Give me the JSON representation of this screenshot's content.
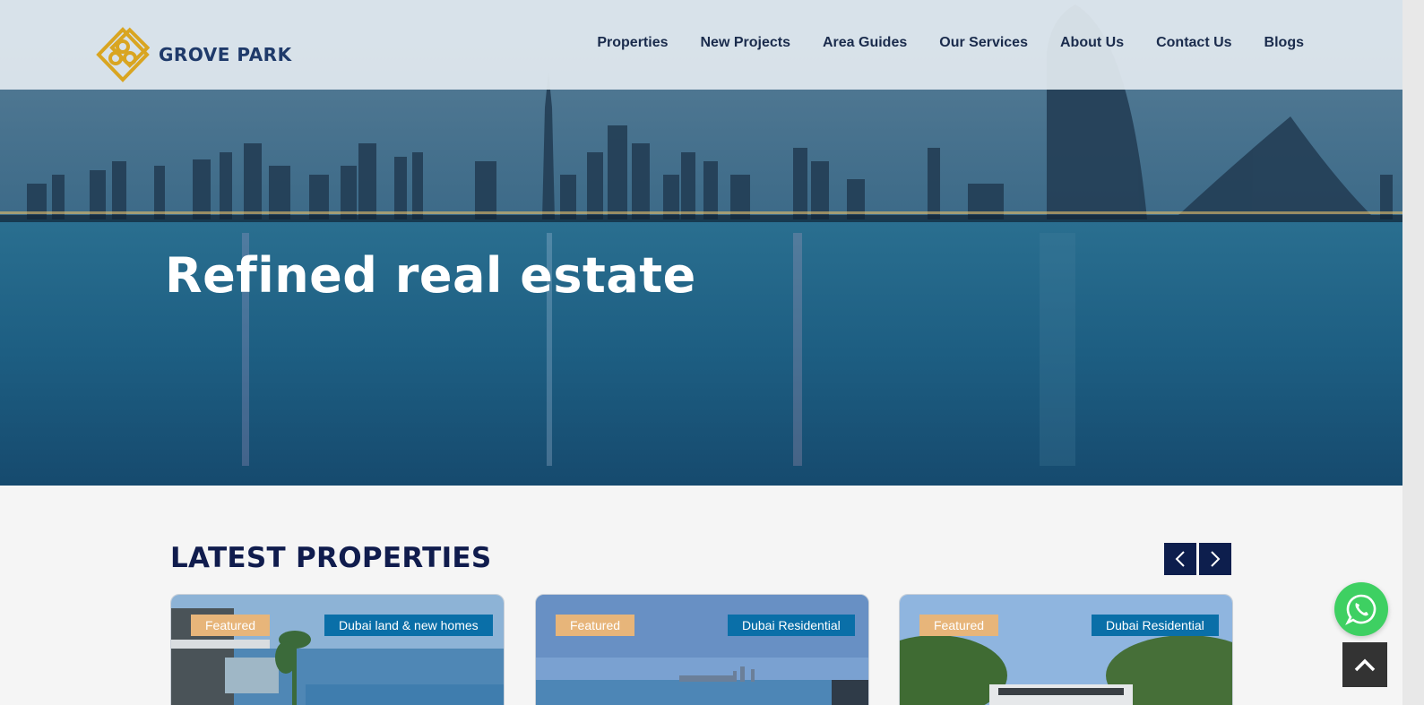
{
  "brand": {
    "name": "GROVE PARK",
    "logo_color": "#d9a521",
    "text_color": "#1f3a6a"
  },
  "nav": {
    "items": [
      {
        "label": "Properties"
      },
      {
        "label": "New Projects"
      },
      {
        "label": "Area Guides"
      },
      {
        "label": "Our Services"
      },
      {
        "label": "About Us"
      },
      {
        "label": "Contact Us"
      },
      {
        "label": "Blogs"
      }
    ]
  },
  "hero": {
    "title": "Refined real estate"
  },
  "latest": {
    "title": "LATEST PROPERTIES",
    "prev_icon": "chevron-left-icon",
    "next_icon": "chevron-right-icon",
    "cards": [
      {
        "featured": "Featured",
        "category": "Dubai land & new homes"
      },
      {
        "featured": "Featured",
        "category": "Dubai Residential"
      },
      {
        "featured": "Featured",
        "category": "Dubai Residential"
      }
    ]
  },
  "widgets": {
    "whatsapp_icon": "whatsapp-icon",
    "scroll_top_icon": "chevron-up-icon"
  },
  "colors": {
    "navy": "#0d1e4d",
    "featured": "#e7b57a",
    "category": "#0a6fa8",
    "whatsapp": "#3ed062"
  }
}
